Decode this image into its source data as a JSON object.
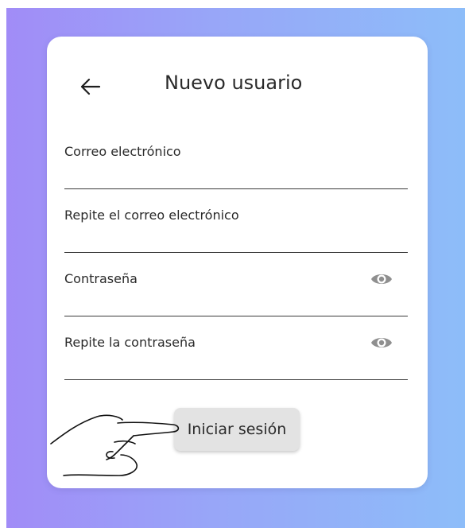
{
  "header": {
    "title": "Nuevo usuario",
    "back_icon": "arrow-left-icon"
  },
  "form": {
    "fields": [
      {
        "label": "Correo electrónico",
        "value": "",
        "icon": null
      },
      {
        "label": "Repite el correo electrónico",
        "value": "",
        "icon": null
      },
      {
        "label": "Contraseña",
        "value": "",
        "icon": "eye-icon"
      },
      {
        "label": "Repite la contraseña",
        "value": "",
        "icon": "eye-icon"
      }
    ],
    "submit_label": "Iniciar sesión"
  },
  "colors": {
    "gradient_start": "#a18cf7",
    "gradient_end": "#8dbdf9",
    "card": "#ffffff",
    "button": "#e3e3e3",
    "eye_icon": "#8f8f8f",
    "text": "#2a2a2a"
  },
  "decorations": {
    "pointer_icon": "pointing-hand-icon"
  }
}
